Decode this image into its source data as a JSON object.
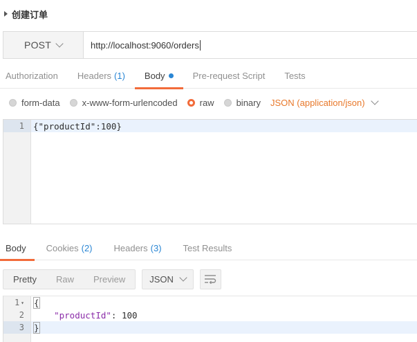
{
  "request": {
    "title": "创建订单",
    "method": "POST",
    "url": "http://localhost:9060/orders"
  },
  "request_tabs": [
    {
      "label": "Authorization",
      "count": ""
    },
    {
      "label": "Headers",
      "count": "(1)"
    },
    {
      "label": "Body",
      "count": ""
    },
    {
      "label": "Pre-request Script",
      "count": ""
    },
    {
      "label": "Tests",
      "count": ""
    }
  ],
  "active_request_tab": "Body",
  "body_options": {
    "items": [
      "form-data",
      "x-www-form-urlencoded",
      "raw",
      "binary"
    ],
    "selected": "raw",
    "content_type": "JSON (application/json)"
  },
  "request_body": {
    "line_numbers": [
      "1"
    ],
    "code": "{\"productId\":100}"
  },
  "response_tabs": [
    {
      "label": "Body",
      "count": ""
    },
    {
      "label": "Cookies",
      "count": "(2)"
    },
    {
      "label": "Headers",
      "count": "(3)"
    },
    {
      "label": "Test Results",
      "count": ""
    }
  ],
  "active_response_tab": "Body",
  "response_view": {
    "modes": [
      "Pretty",
      "Raw",
      "Preview"
    ],
    "selected_mode": "Pretty",
    "format": "JSON"
  },
  "response_body": {
    "line_numbers": [
      "1",
      "2",
      "3"
    ],
    "lines": [
      "{",
      "    \"productId\": 100",
      "}"
    ],
    "key": "\"productId\"",
    "value": "100"
  },
  "colors": {
    "accent": "#f26b3a",
    "link_blue": "#2a86d4",
    "json_key": "#8a2ba8"
  }
}
